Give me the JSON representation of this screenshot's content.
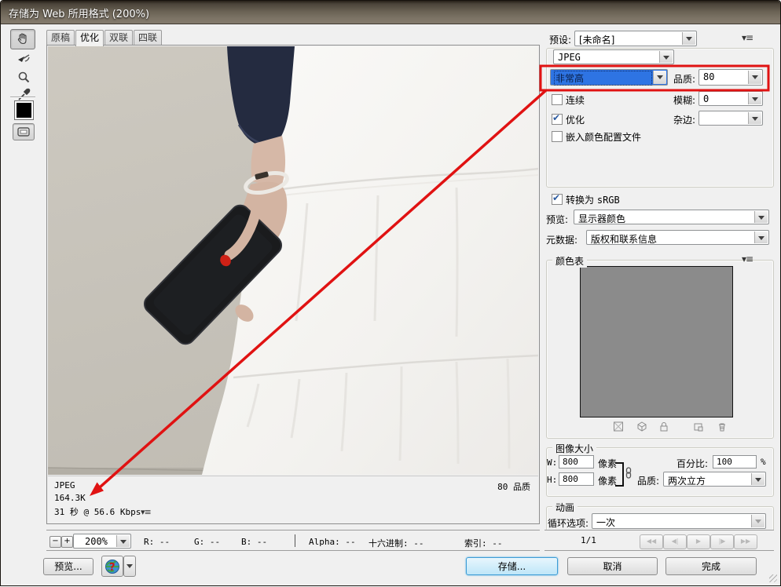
{
  "window": {
    "title": "存储为 Web 所用格式 (200%)"
  },
  "tabs": [
    "原稿",
    "优化",
    "双联",
    "四联"
  ],
  "preview_info": {
    "format": "JPEG",
    "size": "164.3K",
    "time": "31 秒 @ 56.6 Kbps",
    "quality": "80 品质"
  },
  "statusbar": {
    "minus": "−",
    "plus": "+",
    "zoom": "200%",
    "r_label": "R:",
    "g_label": "G:",
    "b_label": "B:",
    "alpha_label": "Alpha:",
    "hex_label": "十六进制:",
    "index_label": "索引:",
    "dash": "--"
  },
  "footer": {
    "preview_button": "预览...",
    "save_button": "存储...",
    "cancel_button": "取消",
    "done_button": "完成"
  },
  "panel": {
    "preset_label": "预设:",
    "preset_value": "[未命名]",
    "format_value": "JPEG",
    "compression_value": "非常高",
    "quality_label": "品质:",
    "quality_value": "80",
    "progressive_label": "连续",
    "progressive_checked": false,
    "blur_label": "模糊:",
    "blur_value": "0",
    "optimized_label": "优化",
    "optimized_checked": true,
    "matte_label": "杂边:",
    "matte_value": "",
    "embed_profile_label": "嵌入颜色配置文件",
    "embed_profile_checked": false,
    "convert_label": "转换为",
    "srgb_label": "sRGB",
    "convert_checked": true,
    "preview_label": "预览:",
    "preview_value": "显示器颜色",
    "metadata_label": "元数据:",
    "metadata_value": "版权和联系信息",
    "color_table": {
      "title": "颜色表"
    },
    "image_size": {
      "title": "图像大小",
      "w_label": "W:",
      "w_value": "800",
      "h_label": "H:",
      "h_value": "800",
      "px_label": "像素",
      "percent_label": "百分比:",
      "percent_value": "100",
      "percent_unit": "%",
      "quality_label": "品质:",
      "quality_value": "两次立方"
    },
    "animation": {
      "title": "动画",
      "loop_label": "循环选项:",
      "loop_value": "一次",
      "frame": "1/1",
      "controls": [
        "◀◀",
        "◀|",
        "▶",
        "|▶",
        "▶▶"
      ]
    }
  },
  "icons": {
    "panel_menu": "▾≡",
    "info_menu": "▾≡"
  },
  "annotations": {
    "highlight_color": "#e01212"
  }
}
